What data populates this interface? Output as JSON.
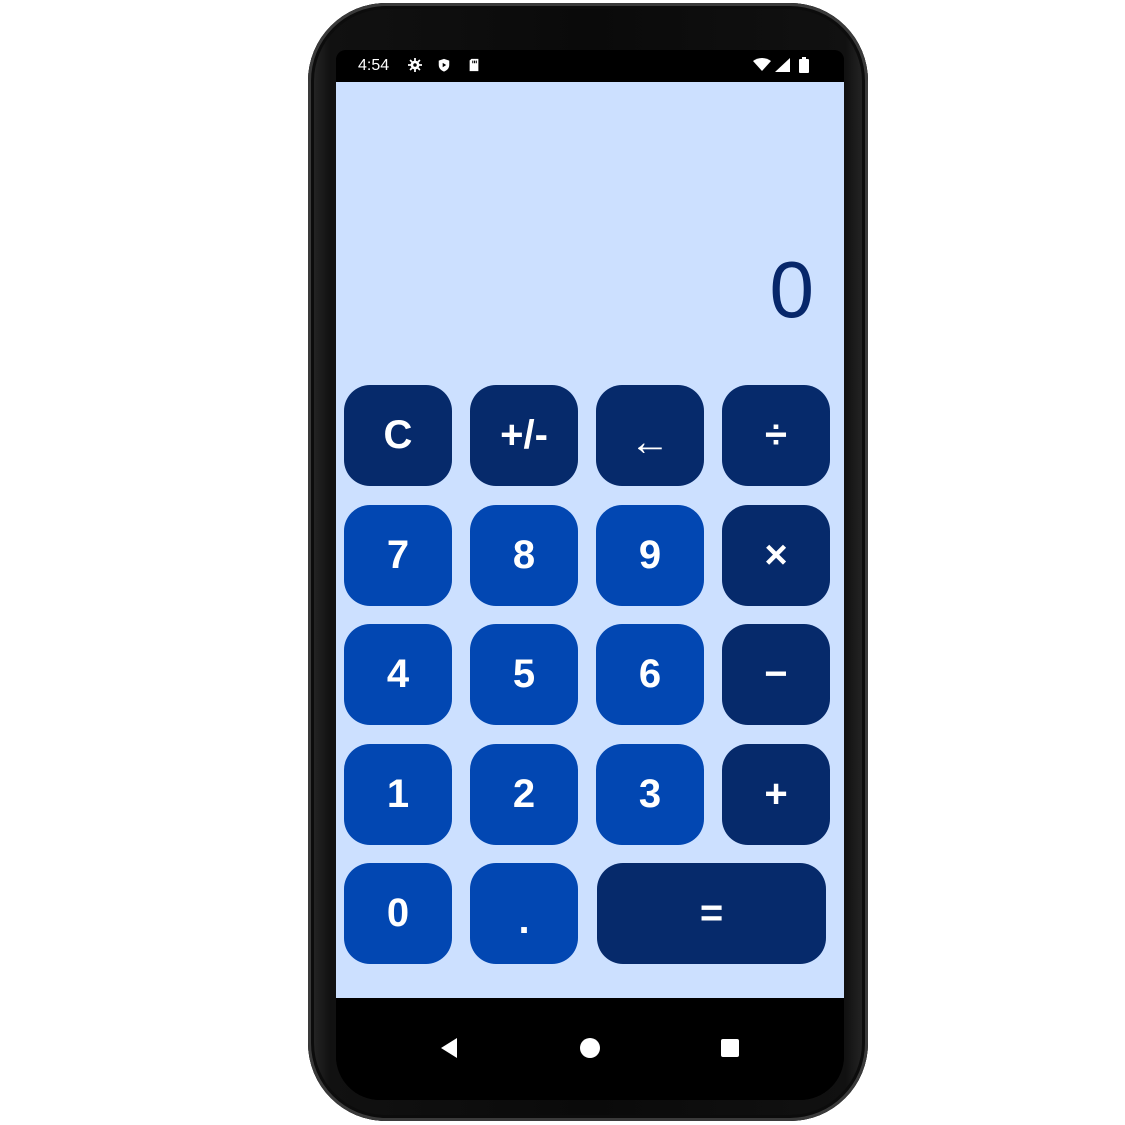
{
  "status_bar": {
    "time": "4:54",
    "left_icons": [
      "gear-icon",
      "shield-icon",
      "sd-card-icon"
    ],
    "right_icons": [
      "wifi-icon",
      "signal-icon",
      "battery-icon"
    ]
  },
  "display": {
    "value": "0"
  },
  "keypad": {
    "rows": [
      [
        {
          "label": "C",
          "style": "dark"
        },
        {
          "label": "+/-",
          "style": "dark"
        },
        {
          "label": "←",
          "style": "dark"
        },
        {
          "label": "÷",
          "style": "dark"
        }
      ],
      [
        {
          "label": "7",
          "style": "blue"
        },
        {
          "label": "8",
          "style": "blue"
        },
        {
          "label": "9",
          "style": "blue"
        },
        {
          "label": "×",
          "style": "dark"
        }
      ],
      [
        {
          "label": "4",
          "style": "blue"
        },
        {
          "label": "5",
          "style": "blue"
        },
        {
          "label": "6",
          "style": "blue"
        },
        {
          "label": "−",
          "style": "dark"
        }
      ],
      [
        {
          "label": "1",
          "style": "blue"
        },
        {
          "label": "2",
          "style": "blue"
        },
        {
          "label": "3",
          "style": "blue"
        },
        {
          "label": "+",
          "style": "dark"
        }
      ],
      [
        {
          "label": "0",
          "style": "blue"
        },
        {
          "label": ".",
          "style": "blue"
        },
        {
          "label": "=",
          "style": "dark"
        }
      ]
    ]
  },
  "nav_bar": {
    "icons": [
      "back-icon",
      "home-icon",
      "recents-icon"
    ]
  },
  "colors": {
    "app_background": "#cce0ff",
    "operator_key": "#062a6b",
    "digit_key": "#0247b2",
    "display_text": "#07276a"
  }
}
